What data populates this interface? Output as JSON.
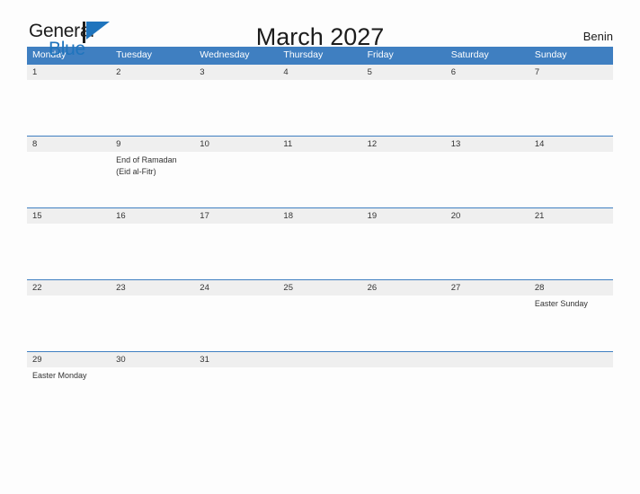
{
  "brand": {
    "name_part1": "General",
    "name_part2": "Blue",
    "accent_color": "#1f74bd",
    "flag_icon": "flag-triangle-icon"
  },
  "header": {
    "title": "March 2027",
    "region": "Benin"
  },
  "colors": {
    "header_blue": "#3f7fc1",
    "date_band_gray": "#efefef",
    "page_background": "#fdfdfd",
    "text": "#333333"
  },
  "calendar": {
    "month": "March",
    "year": "2027",
    "weekday_headers": [
      "Monday",
      "Tuesday",
      "Wednesday",
      "Thursday",
      "Friday",
      "Saturday",
      "Sunday"
    ],
    "weeks": [
      {
        "dates": [
          "1",
          "2",
          "3",
          "4",
          "5",
          "6",
          "7"
        ],
        "notes": [
          [],
          [],
          [],
          [],
          [],
          [],
          []
        ]
      },
      {
        "dates": [
          "8",
          "9",
          "10",
          "11",
          "12",
          "13",
          "14"
        ],
        "notes": [
          [],
          [
            "End of Ramadan",
            "(Eid al-Fitr)"
          ],
          [],
          [],
          [],
          [],
          []
        ]
      },
      {
        "dates": [
          "15",
          "16",
          "17",
          "18",
          "19",
          "20",
          "21"
        ],
        "notes": [
          [],
          [],
          [],
          [],
          [],
          [],
          []
        ]
      },
      {
        "dates": [
          "22",
          "23",
          "24",
          "25",
          "26",
          "27",
          "28"
        ],
        "notes": [
          [],
          [],
          [],
          [],
          [],
          [],
          [
            "Easter Sunday"
          ]
        ]
      },
      {
        "dates": [
          "29",
          "30",
          "31",
          "",
          "",
          "",
          ""
        ],
        "notes": [
          [
            "Easter Monday"
          ],
          [],
          [],
          [],
          [],
          [],
          []
        ]
      }
    ]
  }
}
